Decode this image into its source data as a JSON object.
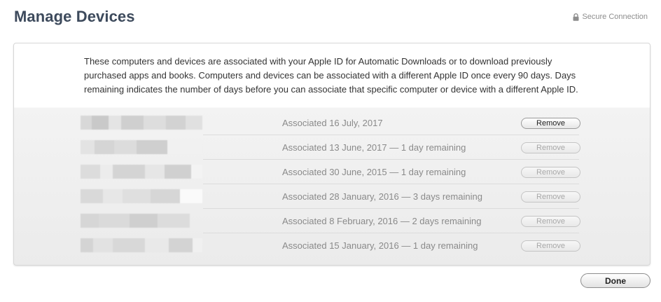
{
  "page": {
    "title": "Manage Devices",
    "secure_label": "Secure Connection"
  },
  "intro_text": "These computers and devices are associated with your Apple ID for Automatic Downloads or to download previously purchased apps and books. Computers and devices can be associated with a different Apple ID once every 90 days. Days remaining indicates the number of days before you can associate that specific computer or device with a different Apple ID.",
  "devices": [
    {
      "status": "Associated 16 July, 2017",
      "button_label": "Remove",
      "enabled": true
    },
    {
      "status": "Associated 13 June, 2017 — 1 day remaining",
      "button_label": "Remove",
      "enabled": false
    },
    {
      "status": "Associated 30 June, 2015 — 1 day remaining",
      "button_label": "Remove",
      "enabled": false
    },
    {
      "status": "Associated 28 January, 2016 — 3 days remaining",
      "button_label": "Remove",
      "enabled": false
    },
    {
      "status": "Associated 8 February, 2016 — 2 days remaining",
      "button_label": "Remove",
      "enabled": false
    },
    {
      "status": "Associated 15 January, 2016 — 1 day remaining",
      "button_label": "Remove",
      "enabled": false
    }
  ],
  "done_label": "Done",
  "icons": {
    "secure": "lock-icon"
  },
  "colors": {
    "title": "#3d4a5c",
    "status_text": "#8a8a8a",
    "panel_border": "#d7d7d7"
  }
}
